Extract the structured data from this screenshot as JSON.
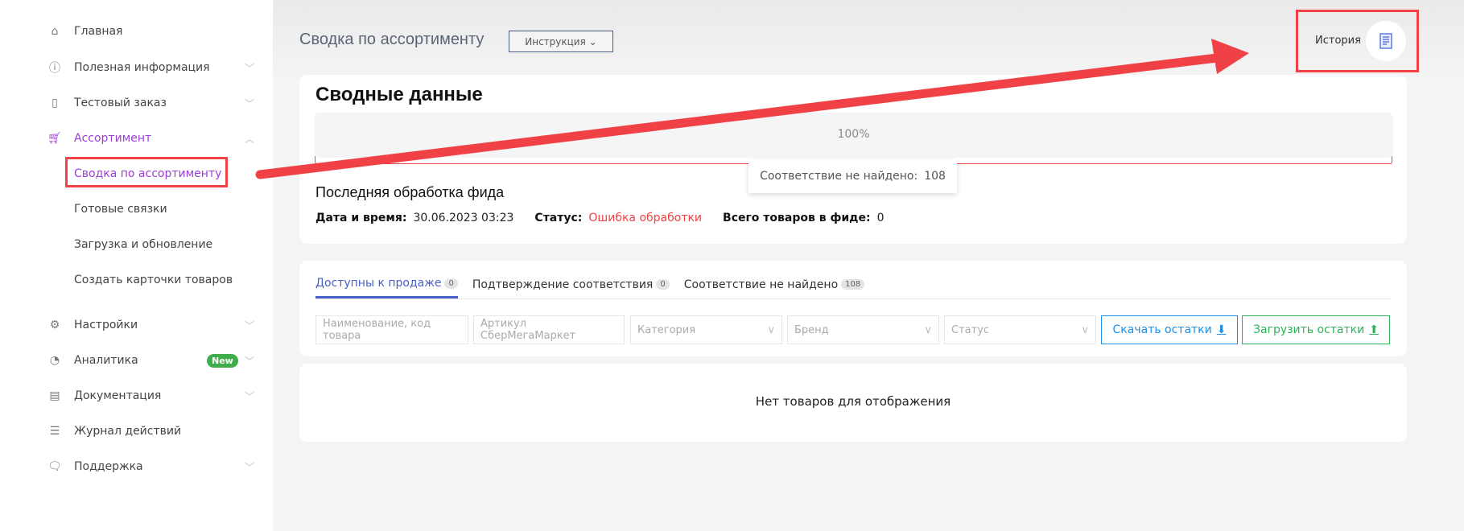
{
  "sidebar": {
    "items": [
      {
        "label": "Главная",
        "icon": "home-icon"
      },
      {
        "label": "Полезная информация",
        "icon": "info-icon"
      },
      {
        "label": "Тестовый заказ",
        "icon": "bag-icon"
      },
      {
        "label": "Ассортимент",
        "icon": "cart-icon"
      },
      {
        "label": "Сводка по ассортименту"
      },
      {
        "label": "Готовые связки"
      },
      {
        "label": "Загрузка и обновление"
      },
      {
        "label": "Создать карточки товаров"
      },
      {
        "label": "Настройки",
        "icon": "gear-icon"
      },
      {
        "label": "Аналитика",
        "icon": "pie-icon",
        "badge": "New"
      },
      {
        "label": "Документация",
        "icon": "document-icon"
      },
      {
        "label": "Журнал действий",
        "icon": "list-icon"
      },
      {
        "label": "Поддержка",
        "icon": "chat-icon"
      }
    ]
  },
  "header": {
    "title": "Сводка по ассортименту",
    "instruction": "Инструкция",
    "history": "История"
  },
  "summary": {
    "title": "Сводные данные",
    "progress_label": "100%",
    "progress": 100,
    "tooltip_label": "Соответствие не найдено:",
    "tooltip_value": "108",
    "last_title": "Последняя обработка фида",
    "date_label": "Дата и время:",
    "date_value": "30.06.2023 03:23",
    "status_label": "Статус:",
    "status_value": "Ошибка обработки",
    "total_label": "Всего товаров в фиде:",
    "total_value": "0"
  },
  "tabs": [
    {
      "label": "Доступны к продаже",
      "count": "0"
    },
    {
      "label": "Подтверждение соответствия",
      "count": "0"
    },
    {
      "label": "Соответствие не найдено",
      "count": "108"
    }
  ],
  "filters": {
    "name_placeholder": "Наименование, код товара",
    "article_placeholder": "Артикул СберМегаМаркет",
    "category": "Категория",
    "brand": "Бренд",
    "status": "Статус",
    "download": "Скачать остатки",
    "upload": "Загрузить остатки"
  },
  "empty": "Нет товаров для отображения",
  "colors": {
    "accent": "#9b3fd6",
    "tab": "#4a60c9",
    "error": "#f04246",
    "download": "#1e90e8",
    "upload": "#2eb35a"
  }
}
